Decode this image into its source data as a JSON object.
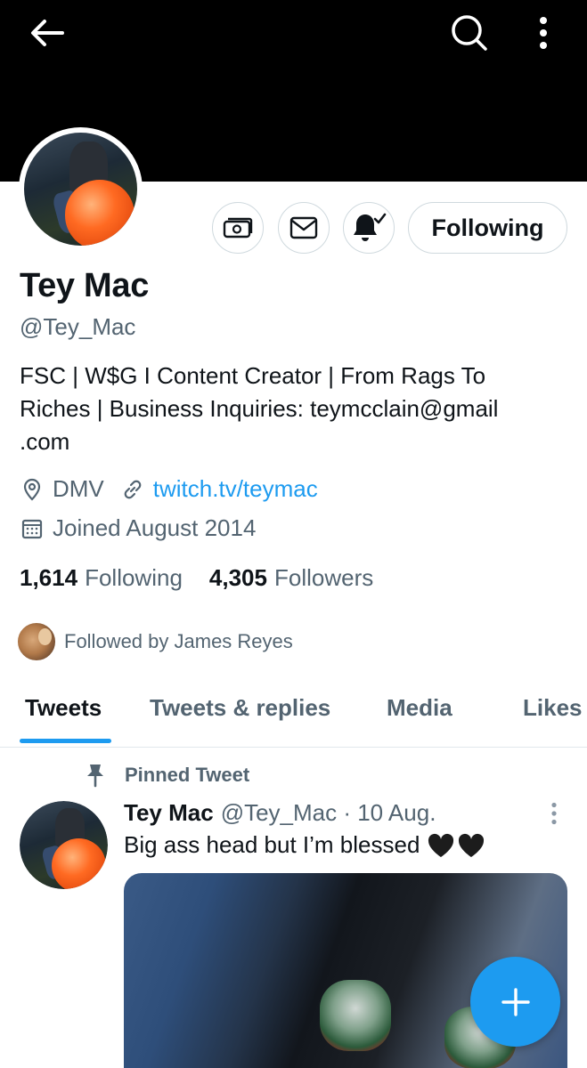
{
  "header": {
    "back_icon": "arrow-left-icon",
    "search_icon": "search-icon",
    "more_icon": "more-vertical-icon"
  },
  "profile": {
    "name": "Tey Mac",
    "handle": "@Tey_Mac",
    "bio": "FSC | W$G I Content Creator | From Rags To Riches | Business Inquiries: teymcclain@gmail .com",
    "location": "DMV",
    "website": "twitch.tv/teymac",
    "joined": "Joined August 2014",
    "following_count": "1,614",
    "following_label": "Following",
    "followers_count": "4,305",
    "followers_label": "Followers",
    "followed_by": "Followed by James Reyes"
  },
  "actions": {
    "tip_icon": "tip-jar-icon",
    "message_icon": "envelope-icon",
    "notify_icon": "bell-check-icon",
    "following_button": "Following"
  },
  "tabs": [
    {
      "label": "Tweets",
      "active": true
    },
    {
      "label": "Tweets & replies",
      "active": false
    },
    {
      "label": "Media",
      "active": false
    },
    {
      "label": "Likes",
      "active": false
    }
  ],
  "pinned_tweet": {
    "pinned_label": "Pinned Tweet",
    "author_name": "Tey Mac",
    "meta": "@Tey_Mac · 10 Aug.",
    "text": "Big ass head but I’m blessed"
  },
  "fab": {
    "icon": "compose-plus-icon"
  },
  "colors": {
    "accent": "#1d9bf0",
    "secondary_text": "#536471",
    "primary_text": "#0f1419",
    "border": "#cfd9de"
  }
}
